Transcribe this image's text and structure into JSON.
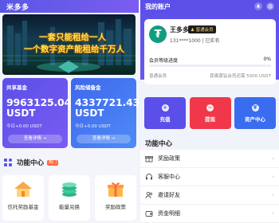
{
  "left": {
    "app_title": "米多多",
    "banner": {
      "line1": "一套只能租给一人",
      "line2": "一个数字资产能租给千万人"
    },
    "funds": [
      {
        "name": "共享基金",
        "amount": "9963125.04",
        "unit": "USDT",
        "today": "今日+0.00 USDT",
        "button": "查看详情 →"
      },
      {
        "name": "风险储备金",
        "amount": "4337721.43",
        "unit": "USDT",
        "today": "今日+0.00 USDT",
        "button": "查看详情 →"
      }
    ],
    "function_center": {
      "title": "功能中心",
      "tag": "热门"
    },
    "tiles": [
      {
        "label": "信托奖励基金",
        "icon": "house-icon"
      },
      {
        "label": "能量兑换",
        "icon": "coins-icon"
      },
      {
        "label": "奖励政策",
        "icon": "gift-icon"
      }
    ]
  },
  "right": {
    "header_title": "我的账户",
    "profile": {
      "avatar_letter": "₮",
      "username": "王多多",
      "badge": "♟ 普通会员",
      "phone": "131****1000 | 已实名",
      "level_label": "会员等级进度",
      "level_percent_text": "0%",
      "level_progress": 0,
      "current_level": "普通会员",
      "next_level_text": "距离黄钻会员还需 5000 USDT"
    },
    "actions": [
      {
        "label": "充值",
        "glyph": "+"
      },
      {
        "label": "提现",
        "glyph": "−"
      },
      {
        "label": "资产中心",
        "glyph": "¥"
      }
    ],
    "function_center_title": "功能中心",
    "menu": [
      {
        "label": "奖励政策",
        "icon": "gift-icon"
      },
      {
        "label": "客服中心",
        "icon": "headset-icon"
      },
      {
        "label": "邀请好友",
        "icon": "users-icon"
      },
      {
        "label": "资金明细",
        "icon": "wallet-icon"
      }
    ],
    "chevron": "›"
  }
}
